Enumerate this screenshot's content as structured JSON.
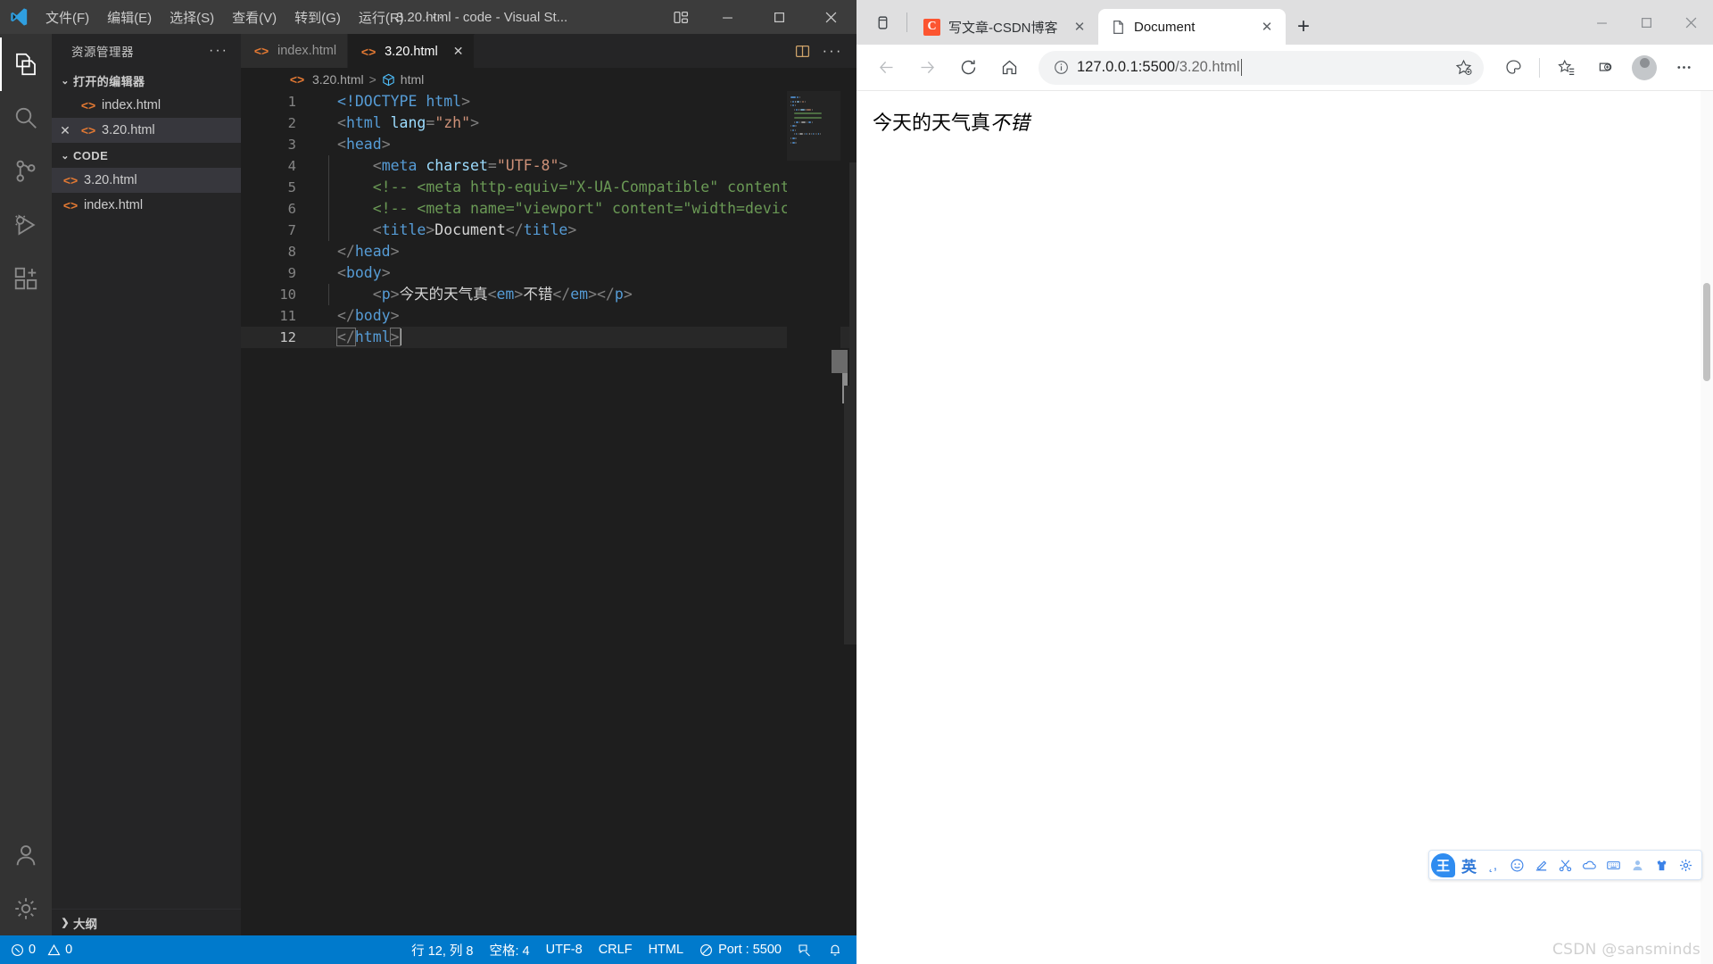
{
  "vscode": {
    "window_title": "3.20.html - code - Visual St...",
    "menus": [
      "文件(F)",
      "编辑(E)",
      "选择(S)",
      "查看(V)",
      "转到(G)",
      "运行(R)",
      "···"
    ],
    "window_buttons": [
      "minimize",
      "maximize",
      "close"
    ],
    "activity_bar": [
      {
        "name": "explorer",
        "icon": "files-icon",
        "active": true
      },
      {
        "name": "search",
        "icon": "search-icon",
        "active": false
      },
      {
        "name": "source-control",
        "icon": "source-control-icon",
        "active": false
      },
      {
        "name": "run-and-debug",
        "icon": "run-debug-icon",
        "active": false
      },
      {
        "name": "extensions",
        "icon": "extensions-icon",
        "active": false
      },
      {
        "name": "accounts",
        "icon": "account-icon",
        "active": false
      },
      {
        "name": "settings",
        "icon": "gear-icon",
        "active": false
      }
    ],
    "sidebar": {
      "title": "资源管理器",
      "more_label": "···",
      "open_editors": {
        "label": "打开的编辑器",
        "items": [
          {
            "name": "index.html",
            "selected": false,
            "show_close": false
          },
          {
            "name": "3.20.html",
            "selected": true,
            "show_close": true
          }
        ]
      },
      "folder": {
        "label": "CODE",
        "items": [
          {
            "name": "3.20.html",
            "selected": true
          },
          {
            "name": "index.html",
            "selected": false
          }
        ]
      },
      "outline_label": "大纲"
    },
    "tabs": [
      {
        "label": "index.html",
        "active": false,
        "show_close": false
      },
      {
        "label": "3.20.html",
        "active": true,
        "show_close": true
      }
    ],
    "tab_actions": [
      {
        "name": "split-editor-icon",
        "label": ""
      },
      {
        "name": "more-actions-icon",
        "label": "···"
      }
    ],
    "breadcrumb": {
      "file": "3.20.html",
      "separator": ">",
      "symbol": "html"
    },
    "editor": {
      "total_lines": 12,
      "current_line": 12,
      "lines": [
        {
          "n": 1,
          "indent": 0,
          "guide": false,
          "tokens": [
            {
              "t": "doctype",
              "v": "<!DOCTYPE "
            },
            {
              "t": "name",
              "v": "html"
            },
            {
              "t": "punct",
              "v": ">"
            }
          ]
        },
        {
          "n": 2,
          "indent": 0,
          "guide": false,
          "tokens": [
            {
              "t": "punct",
              "v": "<"
            },
            {
              "t": "name",
              "v": "html"
            },
            {
              "t": "text_sp",
              "v": " "
            },
            {
              "t": "attr",
              "v": "lang"
            },
            {
              "t": "punct",
              "v": "="
            },
            {
              "t": "str",
              "v": "\"zh\""
            },
            {
              "t": "punct",
              "v": ">"
            }
          ]
        },
        {
          "n": 3,
          "indent": 0,
          "guide": false,
          "tokens": [
            {
              "t": "punct",
              "v": "<"
            },
            {
              "t": "name",
              "v": "head"
            },
            {
              "t": "punct",
              "v": ">"
            }
          ]
        },
        {
          "n": 4,
          "indent": 1,
          "guide": true,
          "tokens": [
            {
              "t": "punct",
              "v": "<"
            },
            {
              "t": "name",
              "v": "meta"
            },
            {
              "t": "text_sp",
              "v": " "
            },
            {
              "t": "attr",
              "v": "charset"
            },
            {
              "t": "punct",
              "v": "="
            },
            {
              "t": "str",
              "v": "\"UTF-8\""
            },
            {
              "t": "punct",
              "v": ">"
            }
          ]
        },
        {
          "n": 5,
          "indent": 1,
          "guide": true,
          "tokens": [
            {
              "t": "comment",
              "v": "<!-- <meta http-equiv=\"X-UA-Compatible\" content=\"I"
            }
          ]
        },
        {
          "n": 6,
          "indent": 1,
          "guide": true,
          "tokens": [
            {
              "t": "comment",
              "v": "<!-- <meta name=\"viewport\" content=\"width=device-w"
            }
          ]
        },
        {
          "n": 7,
          "indent": 1,
          "guide": true,
          "tokens": [
            {
              "t": "punct",
              "v": "<"
            },
            {
              "t": "name",
              "v": "title"
            },
            {
              "t": "punct",
              "v": ">"
            },
            {
              "t": "text",
              "v": "Document"
            },
            {
              "t": "punct",
              "v": "</"
            },
            {
              "t": "name",
              "v": "title"
            },
            {
              "t": "punct",
              "v": ">"
            }
          ]
        },
        {
          "n": 8,
          "indent": 0,
          "guide": false,
          "tokens": [
            {
              "t": "punct",
              "v": "</"
            },
            {
              "t": "name",
              "v": "head"
            },
            {
              "t": "punct",
              "v": ">"
            }
          ]
        },
        {
          "n": 9,
          "indent": 0,
          "guide": false,
          "tokens": [
            {
              "t": "punct",
              "v": "<"
            },
            {
              "t": "name",
              "v": "body"
            },
            {
              "t": "punct",
              "v": ">"
            }
          ]
        },
        {
          "n": 10,
          "indent": 1,
          "guide": true,
          "tokens": [
            {
              "t": "punct",
              "v": "<"
            },
            {
              "t": "name",
              "v": "p"
            },
            {
              "t": "punct",
              "v": ">"
            },
            {
              "t": "text",
              "v": "今天的天气真"
            },
            {
              "t": "punct",
              "v": "<"
            },
            {
              "t": "name",
              "v": "em"
            },
            {
              "t": "punct",
              "v": ">"
            },
            {
              "t": "text",
              "v": "不错"
            },
            {
              "t": "punct",
              "v": "</"
            },
            {
              "t": "name",
              "v": "em"
            },
            {
              "t": "punct",
              "v": ">"
            },
            {
              "t": "punct",
              "v": "</"
            },
            {
              "t": "name",
              "v": "p"
            },
            {
              "t": "punct",
              "v": ">"
            }
          ]
        },
        {
          "n": 11,
          "indent": 0,
          "guide": false,
          "tokens": [
            {
              "t": "punct",
              "v": "</"
            },
            {
              "t": "name",
              "v": "body"
            },
            {
              "t": "punct",
              "v": ">"
            }
          ]
        },
        {
          "n": 12,
          "indent": 0,
          "guide": false,
          "current": true,
          "tokens": [
            {
              "t": "punct",
              "v": "</",
              "box": true
            },
            {
              "t": "name",
              "v": "html"
            },
            {
              "t": "punct",
              "v": ">",
              "box": true
            },
            {
              "t": "caret",
              "v": ""
            }
          ]
        }
      ]
    },
    "statusbar": {
      "errors": "0",
      "warnings": "0",
      "cursor": "行 12, 列 8",
      "indentation": "空格: 4",
      "encoding": "UTF-8",
      "eol": "CRLF",
      "language": "HTML",
      "live_server": "Port : 5500",
      "bell_icon": "bell-icon",
      "feedback_icon": "feedback-icon",
      "accent_color": "#007acc"
    }
  },
  "browser": {
    "tabs": [
      {
        "label": "写文章-CSDN博客",
        "favicon": "csdn-icon",
        "favicon_letter": "C",
        "active": false,
        "close_label": "✕"
      },
      {
        "label": "Document",
        "favicon": "page-icon",
        "active": true,
        "close_label": "✕"
      }
    ],
    "new_tab_label": "+",
    "tab_search_icon": "tab-search-icon",
    "window_buttons": [
      "minimize",
      "maximize",
      "close"
    ],
    "toolbar": {
      "back_icon": "back-arrow-icon",
      "forward_icon": "forward-arrow-icon",
      "reload_icon": "reload-icon",
      "home_icon": "home-icon",
      "info_icon": "site-info-icon",
      "url_host": "127.0.0.1:5500",
      "url_path": "/3.20.html",
      "url_full": "127.0.0.1:5500/3.20.html",
      "favorite_icon": "add-favorite-star-icon",
      "collections_icon": "collections-icon",
      "favorites_icon": "favorites-list-icon",
      "browser_essentials_icon": "browser-essentials-icon",
      "profile_icon": "profile-avatar-icon",
      "settings_icon": "more-options-icon"
    },
    "page": {
      "text_prefix": "今天的天气真",
      "text_em": "不错"
    }
  },
  "ime": {
    "logo_label": "王",
    "mode_label": "英",
    "buttons": [
      {
        "name": "punctuation-icon",
        "label": "，"
      },
      {
        "name": "emoji-icon",
        "label": ""
      },
      {
        "name": "pen-icon",
        "label": ""
      },
      {
        "name": "scissors-icon",
        "label": ""
      },
      {
        "name": "cloud-icon",
        "label": ""
      },
      {
        "name": "keyboard-icon",
        "label": ""
      },
      {
        "name": "user-icon",
        "label": ""
      },
      {
        "name": "skin-icon",
        "label": ""
      },
      {
        "name": "gear-icon",
        "label": ""
      }
    ]
  },
  "watermark": "CSDN @sansminds"
}
